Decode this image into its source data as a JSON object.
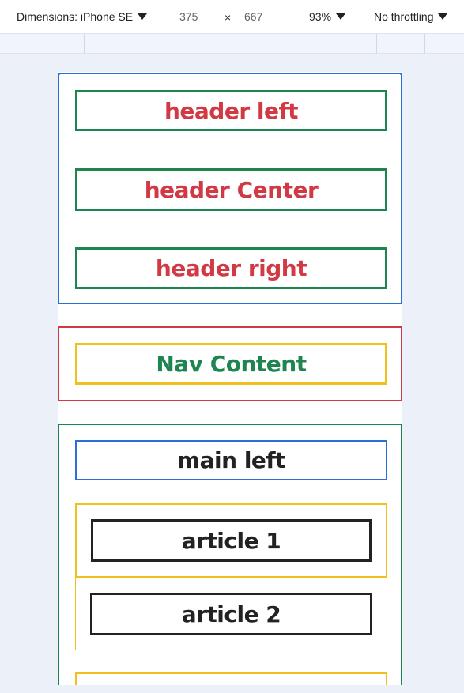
{
  "toolbar": {
    "dimensions_label": "Dimensions: iPhone SE",
    "width": "375",
    "times": "×",
    "height": "667",
    "zoom": "93%",
    "throttling": "No throttling"
  },
  "page": {
    "header": {
      "left": "header left",
      "center": "header Center",
      "right": "header right"
    },
    "nav": {
      "content": "Nav Content"
    },
    "main": {
      "left": "main left",
      "articles": [
        "article 1",
        "article 2"
      ]
    }
  },
  "colors": {
    "header_border": "#2a6fd6",
    "header_item_border": "#1e8450",
    "header_text": "#d13a45",
    "nav_border": "#d13a45",
    "nav_item_border": "#f2bf1d",
    "nav_text": "#1e8450",
    "main_border": "#1e8450",
    "main_left_border": "#2a6fd6",
    "article_container_border": "#f2bf1d",
    "article_border": "#222222"
  }
}
